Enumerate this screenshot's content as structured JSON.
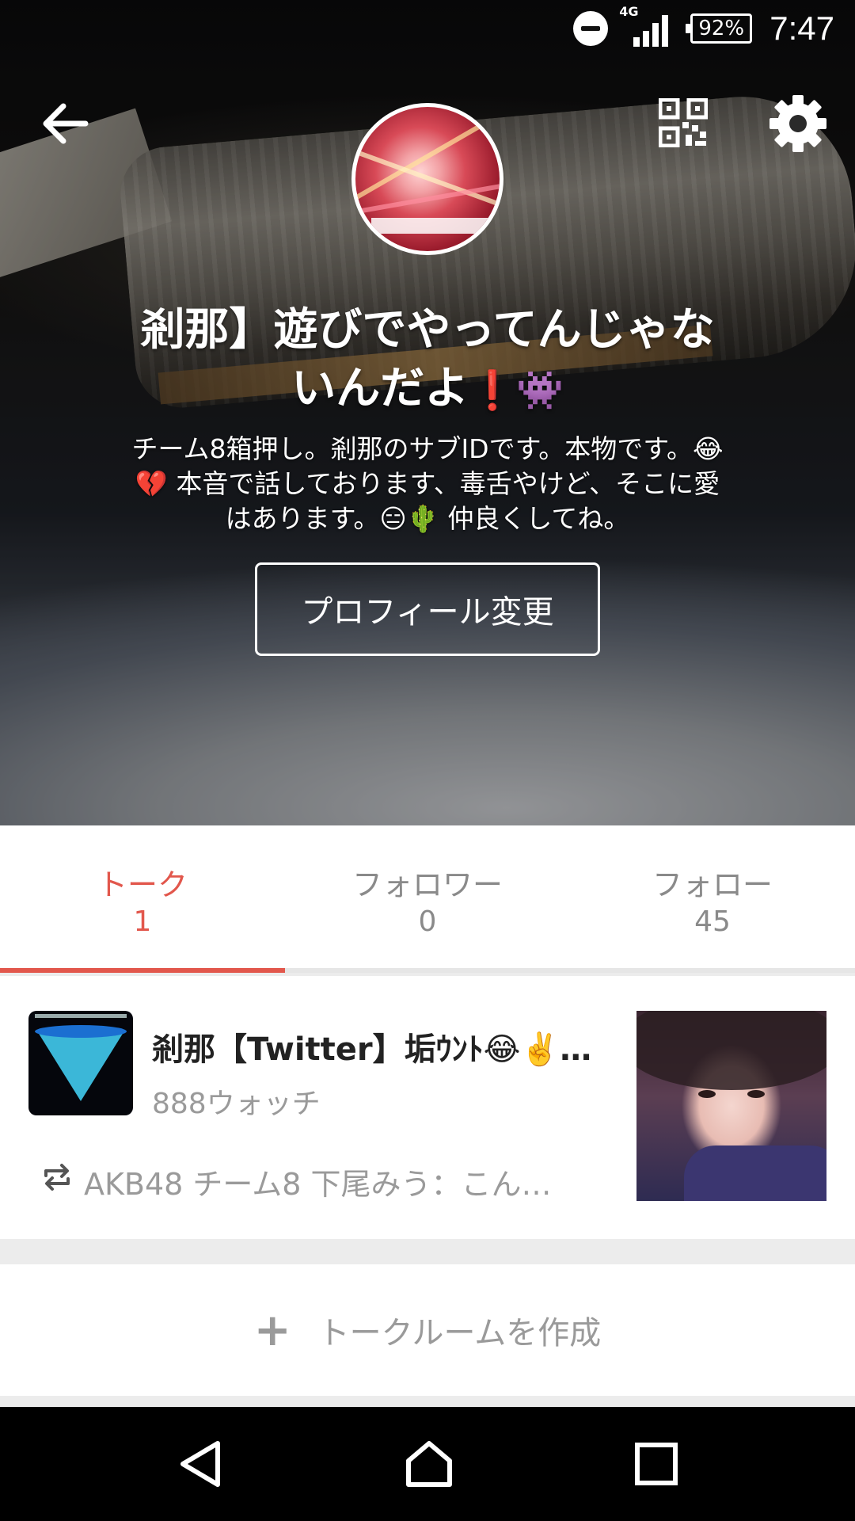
{
  "status_bar": {
    "network": "4G",
    "battery": "92%",
    "time": "7:47"
  },
  "icons": {
    "back": "arrow-left-icon",
    "qr": "qr-code-icon",
    "settings": "gear-icon",
    "repost": "repost-icon",
    "plus": "plus-icon",
    "dnd": "do-not-disturb-icon"
  },
  "profile": {
    "name_line1": "剎那】遊びでやってんじゃな",
    "name_line2": "いんだよ",
    "name_emoji": "❗👾",
    "bio_line1": "チーム8箱押し。剎那のサブIDです。本物です。😂",
    "bio_line2": "💔 本音で話しております、毒舌やけど、そこに愛",
    "bio_line3": "はあります。😑🌵 仲良くしてね。",
    "edit_button_label": "プロフィール変更"
  },
  "tabs": [
    {
      "label": "トーク",
      "count": "1"
    },
    {
      "label": "フォロワー",
      "count": "0"
    },
    {
      "label": "フォロー",
      "count": "45"
    }
  ],
  "talk": {
    "title": "剎那【Twitter】垢ｳﾝﾄ😂✌️の…",
    "subtitle": "888ウォッチ",
    "preview": "AKB48 チーム8 下尾みう：こん…"
  },
  "create_room": {
    "plus": "+",
    "label": "トークルームを作成"
  },
  "colors": {
    "accent": "#e2574c",
    "muted_text": "#9a9a9a",
    "nav_bar": "#000000"
  }
}
